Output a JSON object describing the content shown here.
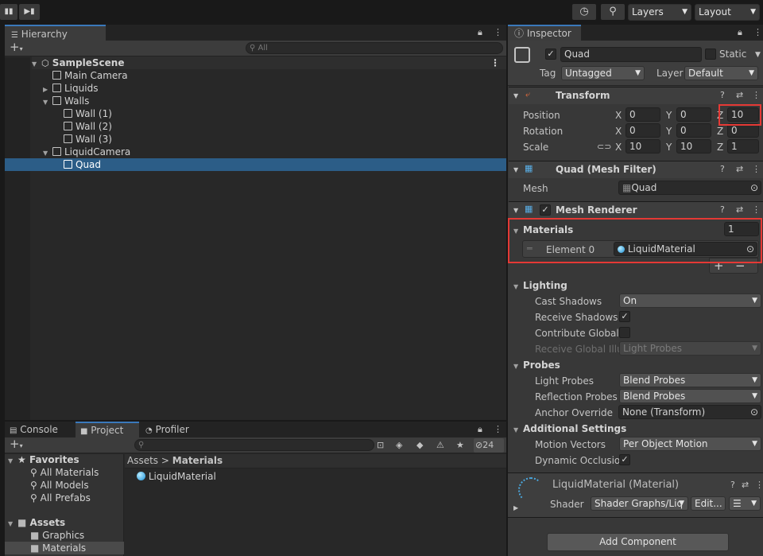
{
  "toolbar": {
    "layers": "Layers",
    "layout": "Layout"
  },
  "hierarchy": {
    "tab": "Hierarchy",
    "search_placeholder": "All",
    "items": [
      {
        "label": "SampleScene"
      },
      {
        "label": "Main Camera"
      },
      {
        "label": "Liquids"
      },
      {
        "label": "Walls"
      },
      {
        "label": "Wall (1)"
      },
      {
        "label": "Wall (2)"
      },
      {
        "label": "Wall (3)"
      },
      {
        "label": "LiquidCamera"
      },
      {
        "label": "Quad"
      }
    ]
  },
  "bottom_tabs": {
    "console": "Console",
    "project": "Project",
    "profiler": "Profiler",
    "count": "24"
  },
  "project": {
    "favorites": "Favorites",
    "fav_items": [
      "All Materials",
      "All Models",
      "All Prefabs"
    ],
    "assets": "Assets",
    "asset_items": [
      "Graphics",
      "Materials"
    ],
    "breadcrumb": {
      "root": "Assets",
      "sep": ">",
      "current": "Materials"
    },
    "files": [
      "LiquidMaterial"
    ]
  },
  "inspector": {
    "tab": "Inspector",
    "name": "Quad",
    "static_label": "Static",
    "tag_label": "Tag",
    "tag_value": "Untagged",
    "layer_label": "Layer",
    "layer_value": "Default",
    "transform": {
      "title": "Transform",
      "position_label": "Position",
      "rotation_label": "Rotation",
      "scale_label": "Scale",
      "x": "X",
      "y": "Y",
      "z": "Z",
      "position": [
        "0",
        "0",
        "10"
      ],
      "rotation": [
        "0",
        "0",
        "0"
      ],
      "scale": [
        "10",
        "10",
        "1"
      ]
    },
    "mesh_filter": {
      "title": "Quad (Mesh Filter)",
      "mesh_label": "Mesh",
      "mesh_value": "Quad"
    },
    "mesh_renderer": {
      "title": "Mesh Renderer",
      "materials_label": "Materials",
      "materials_count": "1",
      "element_label": "Element 0",
      "element_value": "LiquidMaterial",
      "plus": "+",
      "minus": "−",
      "lighting": "Lighting",
      "cast_shadows_label": "Cast Shadows",
      "cast_shadows_value": "On",
      "receive_shadows_label": "Receive Shadows",
      "contribute_gi_label": "Contribute Global I",
      "receive_gi_label": "Receive Global Illu",
      "receive_gi_value": "Light Probes",
      "probes": "Probes",
      "light_probes_label": "Light Probes",
      "light_probes_value": "Blend Probes",
      "reflection_probes_label": "Reflection Probes",
      "reflection_probes_value": "Blend Probes",
      "anchor_label": "Anchor Override",
      "anchor_value": "None (Transform)",
      "additional": "Additional Settings",
      "motion_vectors_label": "Motion Vectors",
      "motion_vectors_value": "Per Object Motion",
      "dynamic_occlusion_label": "Dynamic Occlusio"
    },
    "material": {
      "title": "LiquidMaterial (Material)",
      "shader_label": "Shader",
      "shader_value": "Shader Graphs/Liq",
      "edit": "Edit..."
    },
    "add_component": "Add Component"
  }
}
